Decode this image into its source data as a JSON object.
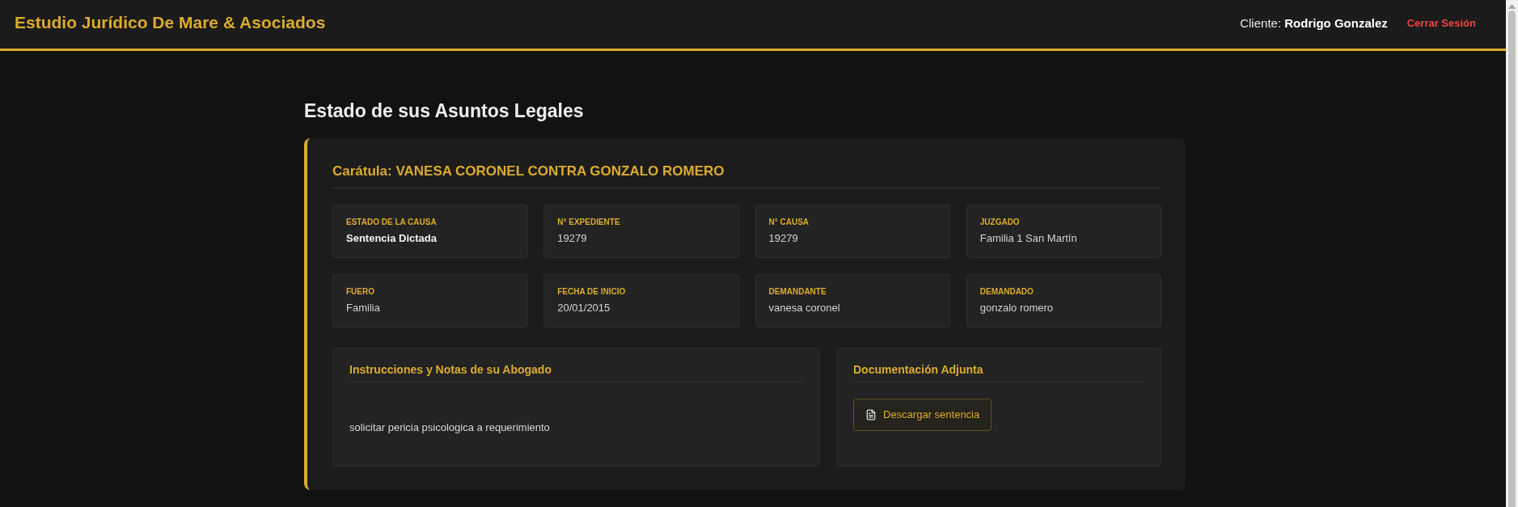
{
  "header": {
    "firm_name": "Estudio Jurídico De Mare & Asociados",
    "client": "Cliente: **Rodrigo Gonzalez**",
    "logout": "Cerrar Sesión"
  },
  "page_title": "Estado de sus Asuntos Legales",
  "cases": [
    {
      "caption": "Carátula: VANESA CORONEL CONTRA GONZALO ROMERO",
      "fields": [
        {
          "label": "ESTADO DE LA CAUSA",
          "value": "Sentencia Dictada",
          "kind": "status"
        },
        {
          "label": "N° EXPEDIENTE",
          "value": "19279",
          "kind": "text"
        },
        {
          "label": "N° CAUSA",
          "value": "19279",
          "kind": "text"
        },
        {
          "label": "JUZGADO",
          "value": "Familia 1 San Martín",
          "kind": "text"
        },
        {
          "label": "FUERO",
          "value": "Familia",
          "kind": "text"
        },
        {
          "label": "FECHA DE INICIO",
          "value": "20/01/2015",
          "kind": "text"
        },
        {
          "label": "DEMANDANTE",
          "value": "vanesa coronel",
          "kind": "text"
        },
        {
          "label": "DEMANDADO",
          "value": "gonzalo romero",
          "kind": "text"
        }
      ],
      "notes": {
        "title": "Instrucciones y Notas de su Abogado",
        "text": "solicitar pericia psicologica a requerimiento"
      },
      "documents": {
        "title": "Documentación Adjunta",
        "files": [
          {
            "label": "Descargar sentencia"
          }
        ]
      }
    }
  ]
}
